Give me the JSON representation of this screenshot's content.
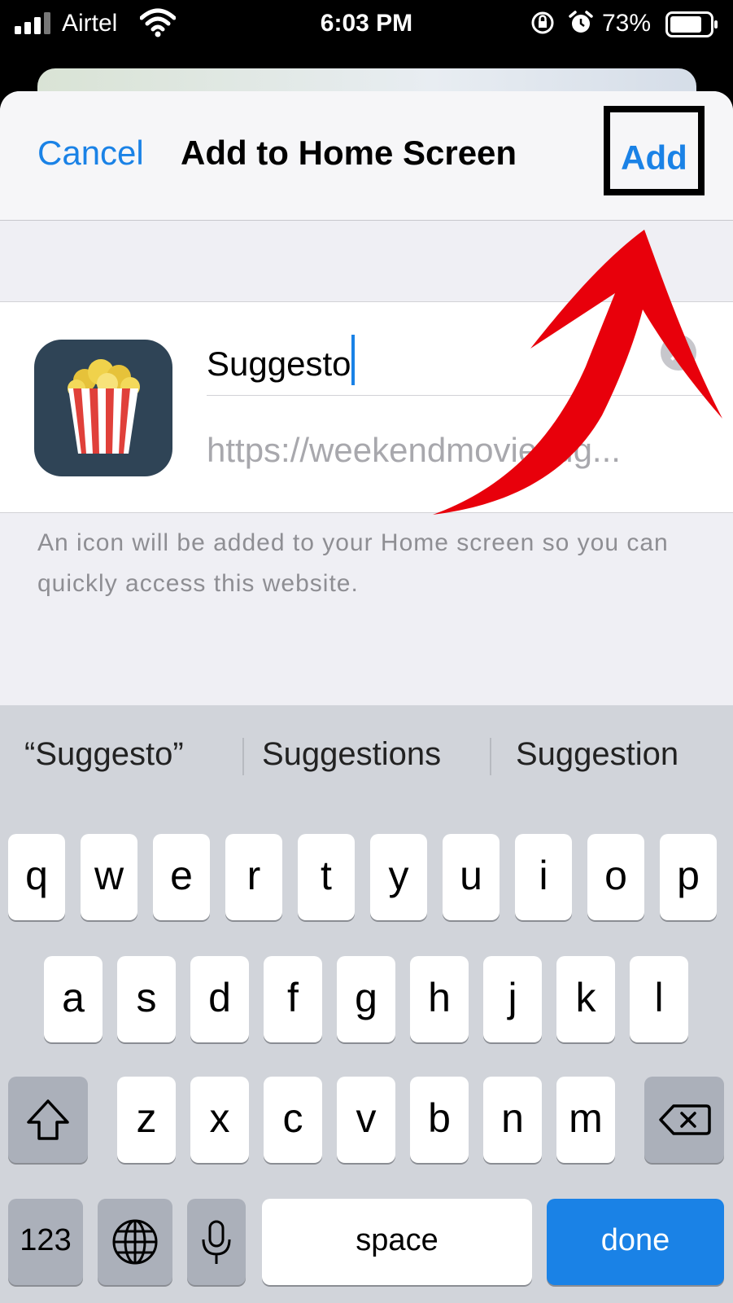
{
  "status_bar": {
    "carrier": "Airtel",
    "time": "6:03 PM",
    "battery_percent": "73%",
    "icons": [
      "signal-icon",
      "wifi-icon",
      "orientation-lock-icon",
      "alarm-icon",
      "battery-icon"
    ]
  },
  "nav": {
    "cancel_label": "Cancel",
    "title": "Add to Home Screen",
    "add_label": "Add"
  },
  "bookmark": {
    "icon": "popcorn-icon",
    "name_value": "Suggesto",
    "url": "https://weekendmoviesug..."
  },
  "description": "An icon will be added to your Home screen so you can quickly access this website.",
  "annotation": {
    "arrow_color": "#e8000b",
    "highlight_box_color": "#000000"
  },
  "keyboard": {
    "suggestions": [
      "“Suggesto”",
      "Suggestions",
      "Suggestion"
    ],
    "row1": [
      "q",
      "w",
      "e",
      "r",
      "t",
      "y",
      "u",
      "i",
      "o",
      "p"
    ],
    "row2": [
      "a",
      "s",
      "d",
      "f",
      "g",
      "h",
      "j",
      "k",
      "l"
    ],
    "row3": [
      "z",
      "x",
      "c",
      "v",
      "b",
      "n",
      "m"
    ],
    "numbers_label": "123",
    "space_label": "space",
    "done_label": "done"
  },
  "colors": {
    "accent": "#1a82e6",
    "sheet_bg": "#efeff4",
    "keyboard_bg": "#d1d4da"
  }
}
